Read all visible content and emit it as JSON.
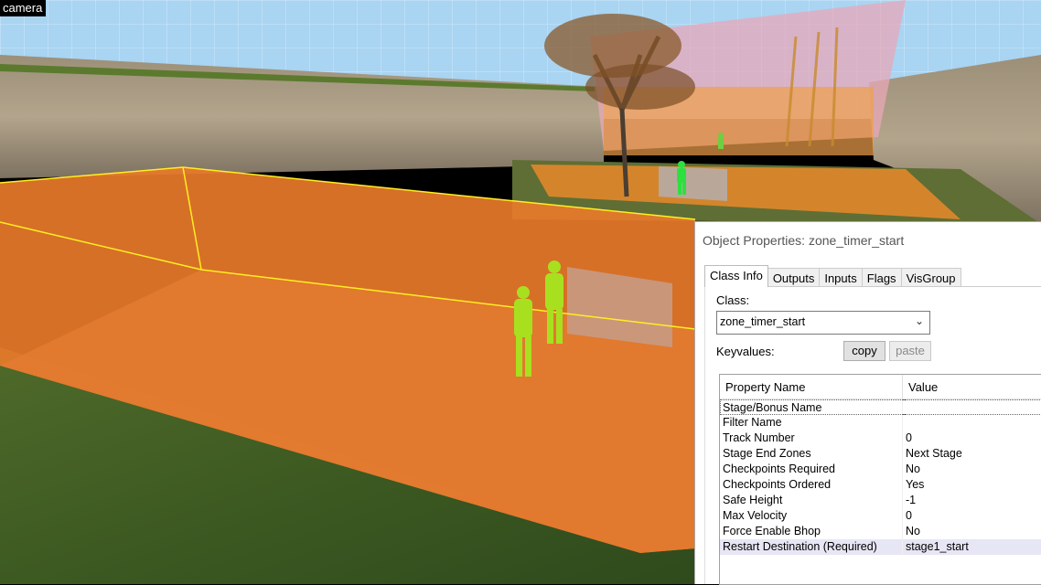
{
  "viewport": {
    "camera_label": "camera"
  },
  "dialog": {
    "title": "Object Properties: zone_timer_start",
    "tabs": [
      {
        "label": "Class Info",
        "active": true
      },
      {
        "label": "Outputs",
        "active": false
      },
      {
        "label": "Inputs",
        "active": false
      },
      {
        "label": "Flags",
        "active": false
      },
      {
        "label": "VisGroup",
        "active": false
      }
    ],
    "class_label": "Class:",
    "class_value": "zone_timer_start",
    "keyvalues_label": "Keyvalues:",
    "copy_label": "copy",
    "paste_label": "paste",
    "table": {
      "headers": [
        "Property Name",
        "Value"
      ],
      "rows": [
        {
          "name": "Stage/Bonus Name",
          "value": ""
        },
        {
          "name": "Filter Name",
          "value": ""
        },
        {
          "name": "Track Number",
          "value": "0"
        },
        {
          "name": "Stage End Zones",
          "value": "Next Stage"
        },
        {
          "name": "Checkpoints Required",
          "value": "No"
        },
        {
          "name": "Checkpoints Ordered",
          "value": "Yes"
        },
        {
          "name": "Safe Height",
          "value": "-1"
        },
        {
          "name": "Max Velocity",
          "value": "0"
        },
        {
          "name": "Force Enable Bhop",
          "value": "No"
        },
        {
          "name": "Restart Destination (Required)",
          "value": "stage1_start"
        }
      ]
    }
  }
}
